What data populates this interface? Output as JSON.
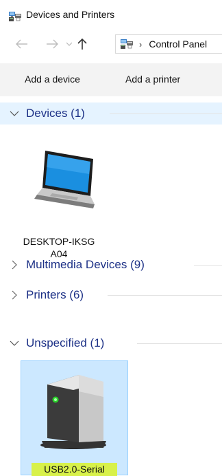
{
  "window": {
    "title": "Devices and Printers",
    "icon": "devices-printers-icon"
  },
  "addressbar": {
    "back_icon": "arrow-left-icon",
    "forward_icon": "arrow-right-icon",
    "recent_icon": "chevron-down-icon",
    "up_icon": "arrow-up-icon",
    "breadcrumb_separator": "›",
    "breadcrumb": [
      "Control Panel"
    ]
  },
  "toolbar": {
    "add_device_label": "Add a device",
    "add_printer_label": "Add a printer"
  },
  "groups": [
    {
      "label": "Devices (1)",
      "expanded": true,
      "selected": true
    },
    {
      "label": "Multimedia Devices (9)",
      "expanded": false,
      "selected": false
    },
    {
      "label": "Printers (6)",
      "expanded": false,
      "selected": false
    },
    {
      "label": "Unspecified (1)",
      "expanded": true,
      "selected": false
    }
  ],
  "devices": {
    "desktop": {
      "name": "DESKTOP-IKSGA04",
      "icon": "laptop-icon"
    },
    "usb": {
      "name": "USB2.0-Serial",
      "icon": "usb-device-icon",
      "selected": true
    }
  },
  "colors": {
    "group_label": "#1e3287",
    "selected_group_bg": "#e5f3ff",
    "selected_tile_bg": "#cce8ff",
    "selected_tile_border": "#99d1ff",
    "name_highlight": "#d8f14a",
    "toolbar_bg": "#f3f3f3"
  }
}
